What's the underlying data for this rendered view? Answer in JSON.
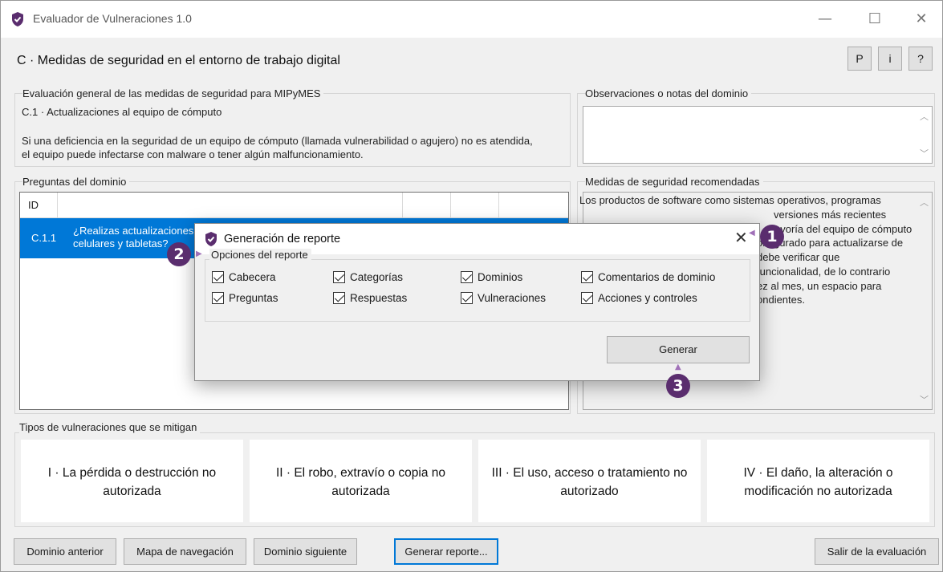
{
  "window": {
    "title": "Evaluador de Vulneraciones 1.0",
    "minimize": "—",
    "maximize": "☐",
    "close": "✕"
  },
  "header": {
    "domain_title": "C · Medidas de seguridad en el entorno de trabajo digital",
    "buttons": [
      "P",
      "i",
      "?"
    ]
  },
  "evaluation": {
    "label": "Evaluación general de las medidas de seguridad para MIPyMES",
    "item": "C.1 · Actualizaciones al equipo de cómputo",
    "desc_line1": "Si una deficiencia en la seguridad de un equipo de cómputo (llamada vulnerabilidad o agujero) no es atendida,",
    "desc_line2": "el equipo puede infectarse con malware o tener algún malfuncionamiento."
  },
  "notes": {
    "label": "Observaciones o notas del dominio",
    "value": ""
  },
  "questions": {
    "label": "Preguntas del dominio",
    "columns": [
      "ID",
      "",
      "",
      "",
      ""
    ],
    "rows": [
      {
        "id": "C.1.1",
        "line1": "¿Realizas actualizaciones",
        "line2": "celulares y tabletas?"
      }
    ]
  },
  "recommended": {
    "label": "Medidas de seguridad recomendadas",
    "lines_right": [
      "Los productos de software como sistemas operativos, programas",
      "versiones más recientes",
      "ayoría del equipo de cómputo",
      "onfigurado para actualizarse de",
      "debe verificar que",
      "funcionalidad, de lo contrario",
      "ez al mes, un espacio para",
      "ondientes."
    ]
  },
  "vulnerabilities": {
    "label": "Tipos de vulneraciones que se mitigan",
    "types": [
      {
        "line1": "I · La pérdida o destrucción no",
        "line2": "autorizada"
      },
      {
        "line1": "II · El robo, extravío o copia no",
        "line2": "autorizada"
      },
      {
        "line1": "III · El uso, acceso o tratamiento no",
        "line2": "autorizado"
      },
      {
        "line1": "IV · El daño, la alteración o",
        "line2": "modificación no autorizada"
      }
    ]
  },
  "bottom_buttons": {
    "prev": "Dominio anterior",
    "map": "Mapa de navegación",
    "next": "Dominio siguiente",
    "report": "Generar reporte...",
    "exit": "Salir de la evaluación"
  },
  "dialog": {
    "title": "Generación de reporte",
    "close": "✕",
    "options_label": "Opciones del reporte",
    "options": [
      "Cabecera",
      "Categorías",
      "Dominios",
      "Comentarios de dominio",
      "Preguntas",
      "Respuestas",
      "Vulneraciones",
      "Acciones y controles"
    ],
    "options_checked": [
      true,
      true,
      true,
      true,
      true,
      true,
      true,
      true
    ],
    "generate": "Generar"
  },
  "markers": [
    "1",
    "2",
    "3"
  ],
  "colors": {
    "selection": "#0078d7",
    "marker": "#5a2d6e",
    "shield": "#5a2d6e"
  }
}
